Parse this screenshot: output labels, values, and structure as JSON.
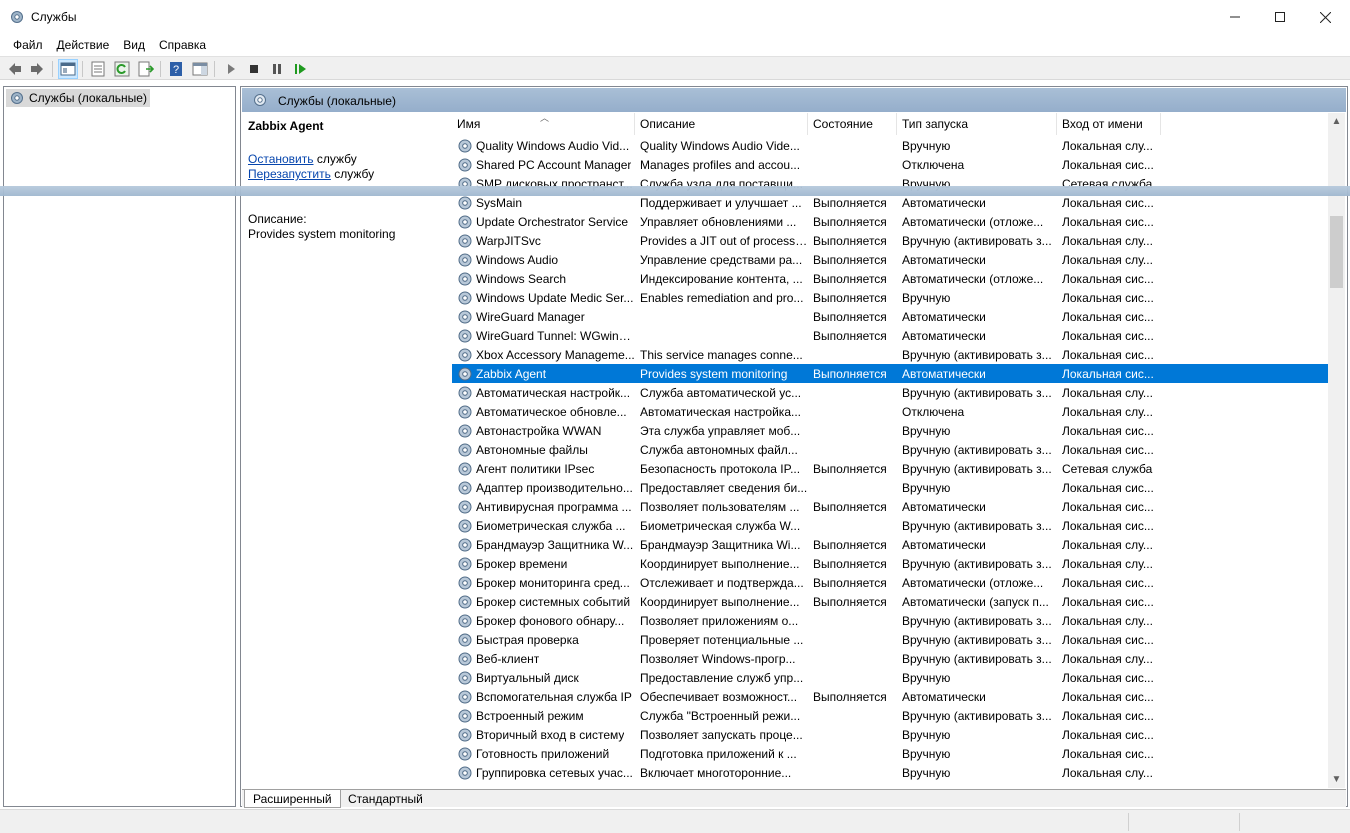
{
  "window": {
    "title": "Службы"
  },
  "menu": [
    "Файл",
    "Действие",
    "Вид",
    "Справка"
  ],
  "tree": {
    "root": "Службы (локальные)"
  },
  "pane_header": "Службы (локальные)",
  "details": {
    "service_name": "Zabbix Agent",
    "stop_link": "Остановить",
    "stop_suffix": " службу",
    "restart_link": "Перезапустить",
    "restart_suffix": " службу",
    "desc_label": "Описание:",
    "desc_text": "Provides system monitoring"
  },
  "columns": [
    "Имя",
    "Описание",
    "Состояние",
    "Тип запуска",
    "Вход от имени"
  ],
  "rows": [
    {
      "name": "Quality Windows Audio Vid...",
      "desc": "Quality Windows Audio Vide...",
      "state": "",
      "type": "Вручную",
      "logon": "Локальная слу..."
    },
    {
      "name": "Shared PC Account Manager",
      "desc": "Manages profiles and accou...",
      "state": "",
      "type": "Отключена",
      "logon": "Локальная сис..."
    },
    {
      "name": "SMP дисковых пространст...",
      "desc": "Служба узла для поставщи...",
      "state": "",
      "type": "Вручную",
      "logon": "Сетевая служба"
    },
    {
      "name": "SysMain",
      "desc": "Поддерживает и улучшает ...",
      "state": "Выполняется",
      "type": "Автоматически",
      "logon": "Локальная сис..."
    },
    {
      "name": "Update Orchestrator Service",
      "desc": "Управляет обновлениями ...",
      "state": "Выполняется",
      "type": "Автоматически (отложе...",
      "logon": "Локальная сис..."
    },
    {
      "name": "WarpJITSvc",
      "desc": "Provides a JIT out of process ...",
      "state": "Выполняется",
      "type": "Вручную (активировать з...",
      "logon": "Локальная слу..."
    },
    {
      "name": "Windows Audio",
      "desc": "Управление средствами ра...",
      "state": "Выполняется",
      "type": "Автоматически",
      "logon": "Локальная слу..."
    },
    {
      "name": "Windows Search",
      "desc": "Индексирование контента, ...",
      "state": "Выполняется",
      "type": "Автоматически (отложе...",
      "logon": "Локальная сис..."
    },
    {
      "name": "Windows Update Medic Ser...",
      "desc": "Enables remediation and pro...",
      "state": "Выполняется",
      "type": "Вручную",
      "logon": "Локальная сис..."
    },
    {
      "name": "WireGuard Manager",
      "desc": "",
      "state": "Выполняется",
      "type": "Автоматически",
      "logon": "Локальная сис..."
    },
    {
      "name": "WireGuard Tunnel: WGwin1...",
      "desc": "",
      "state": "Выполняется",
      "type": "Автоматически",
      "logon": "Локальная сис..."
    },
    {
      "name": "Xbox Accessory Manageme...",
      "desc": "This service manages conne...",
      "state": "",
      "type": "Вручную (активировать з...",
      "logon": "Локальная сис..."
    },
    {
      "name": "Zabbix Agent",
      "desc": "Provides system monitoring",
      "state": "Выполняется",
      "type": "Автоматически",
      "logon": "Локальная сис...",
      "selected": true
    },
    {
      "name": "Автоматическая настройк...",
      "desc": "Служба автоматической ус...",
      "state": "",
      "type": "Вручную (активировать з...",
      "logon": "Локальная слу..."
    },
    {
      "name": "Автоматическое обновле...",
      "desc": "Автоматическая настройка...",
      "state": "",
      "type": "Отключена",
      "logon": "Локальная слу..."
    },
    {
      "name": "Автонастройка WWAN",
      "desc": "Эта служба управляет моб...",
      "state": "",
      "type": "Вручную",
      "logon": "Локальная сис..."
    },
    {
      "name": "Автономные файлы",
      "desc": "Служба автономных файл...",
      "state": "",
      "type": "Вручную (активировать з...",
      "logon": "Локальная сис..."
    },
    {
      "name": "Агент политики IPsec",
      "desc": "Безопасность протокола IP...",
      "state": "Выполняется",
      "type": "Вручную (активировать з...",
      "logon": "Сетевая служба"
    },
    {
      "name": "Адаптер производительно...",
      "desc": "Предоставляет сведения би...",
      "state": "",
      "type": "Вручную",
      "logon": "Локальная сис..."
    },
    {
      "name": "Антивирусная программа ...",
      "desc": "Позволяет пользователям ...",
      "state": "Выполняется",
      "type": "Автоматически",
      "logon": "Локальная сис..."
    },
    {
      "name": "Биометрическая служба ...",
      "desc": "Биометрическая служба W...",
      "state": "",
      "type": "Вручную (активировать з...",
      "logon": "Локальная сис..."
    },
    {
      "name": "Брандмауэр Защитника W...",
      "desc": "Брандмауэр Защитника Wi...",
      "state": "Выполняется",
      "type": "Автоматически",
      "logon": "Локальная слу..."
    },
    {
      "name": "Брокер времени",
      "desc": "Координирует выполнение...",
      "state": "Выполняется",
      "type": "Вручную (активировать з...",
      "logon": "Локальная слу..."
    },
    {
      "name": "Брокер мониторинга сред...",
      "desc": "Отслеживает и подтвержда...",
      "state": "Выполняется",
      "type": "Автоматически (отложе...",
      "logon": "Локальная сис..."
    },
    {
      "name": "Брокер системных событий",
      "desc": "Координирует выполнение...",
      "state": "Выполняется",
      "type": "Автоматически (запуск п...",
      "logon": "Локальная сис..."
    },
    {
      "name": "Брокер фонового обнару...",
      "desc": "Позволяет приложениям о...",
      "state": "",
      "type": "Вручную (активировать з...",
      "logon": "Локальная слу..."
    },
    {
      "name": "Быстрая проверка",
      "desc": "Проверяет потенциальные ...",
      "state": "",
      "type": "Вручную (активировать з...",
      "logon": "Локальная сис..."
    },
    {
      "name": "Веб-клиент",
      "desc": "Позволяет Windows-прогр...",
      "state": "",
      "type": "Вручную (активировать з...",
      "logon": "Локальная слу..."
    },
    {
      "name": "Виртуальный диск",
      "desc": "Предоставление служб упр...",
      "state": "",
      "type": "Вручную",
      "logon": "Локальная сис..."
    },
    {
      "name": "Вспомогательная служба IP",
      "desc": "Обеспечивает возможност...",
      "state": "Выполняется",
      "type": "Автоматически",
      "logon": "Локальная сис..."
    },
    {
      "name": "Встроенный режим",
      "desc": "Служба \"Встроенный режи...",
      "state": "",
      "type": "Вручную (активировать з...",
      "logon": "Локальная сис..."
    },
    {
      "name": "Вторичный вход в систему",
      "desc": "Позволяет запускать проце...",
      "state": "",
      "type": "Вручную",
      "logon": "Локальная сис..."
    },
    {
      "name": "Готовность приложений",
      "desc": "Подготовка приложений к ...",
      "state": "",
      "type": "Вручную",
      "logon": "Локальная сис..."
    },
    {
      "name": "Группировка сетевых учас...",
      "desc": "Включает многоторонние...",
      "state": "",
      "type": "Вручную",
      "logon": "Локальная слу..."
    }
  ],
  "tabs": [
    "Расширенный",
    "Стандартный"
  ],
  "colors": {
    "selection": "#0078d7",
    "pane_header": "#a9bfd6",
    "link": "#0645ad"
  }
}
